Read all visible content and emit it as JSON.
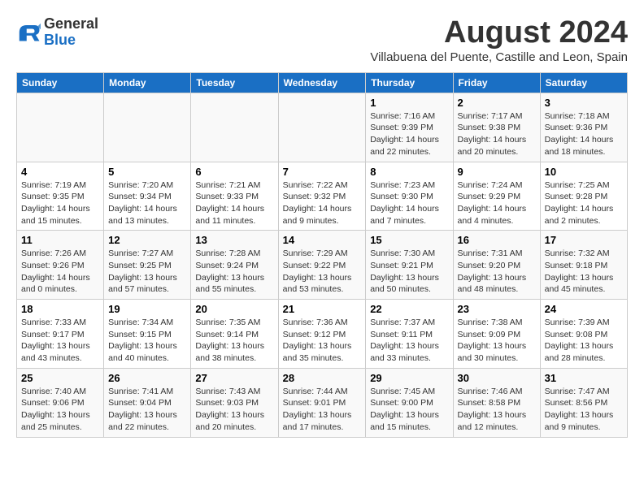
{
  "header": {
    "logo_general": "General",
    "logo_blue": "Blue",
    "month_title": "August 2024",
    "location": "Villabuena del Puente, Castille and Leon, Spain"
  },
  "weekdays": [
    "Sunday",
    "Monday",
    "Tuesday",
    "Wednesday",
    "Thursday",
    "Friday",
    "Saturday"
  ],
  "weeks": [
    [
      {
        "day": "",
        "info": ""
      },
      {
        "day": "",
        "info": ""
      },
      {
        "day": "",
        "info": ""
      },
      {
        "day": "",
        "info": ""
      },
      {
        "day": "1",
        "info": "Sunrise: 7:16 AM\nSunset: 9:39 PM\nDaylight: 14 hours\nand 22 minutes."
      },
      {
        "day": "2",
        "info": "Sunrise: 7:17 AM\nSunset: 9:38 PM\nDaylight: 14 hours\nand 20 minutes."
      },
      {
        "day": "3",
        "info": "Sunrise: 7:18 AM\nSunset: 9:36 PM\nDaylight: 14 hours\nand 18 minutes."
      }
    ],
    [
      {
        "day": "4",
        "info": "Sunrise: 7:19 AM\nSunset: 9:35 PM\nDaylight: 14 hours\nand 15 minutes."
      },
      {
        "day": "5",
        "info": "Sunrise: 7:20 AM\nSunset: 9:34 PM\nDaylight: 14 hours\nand 13 minutes."
      },
      {
        "day": "6",
        "info": "Sunrise: 7:21 AM\nSunset: 9:33 PM\nDaylight: 14 hours\nand 11 minutes."
      },
      {
        "day": "7",
        "info": "Sunrise: 7:22 AM\nSunset: 9:32 PM\nDaylight: 14 hours\nand 9 minutes."
      },
      {
        "day": "8",
        "info": "Sunrise: 7:23 AM\nSunset: 9:30 PM\nDaylight: 14 hours\nand 7 minutes."
      },
      {
        "day": "9",
        "info": "Sunrise: 7:24 AM\nSunset: 9:29 PM\nDaylight: 14 hours\nand 4 minutes."
      },
      {
        "day": "10",
        "info": "Sunrise: 7:25 AM\nSunset: 9:28 PM\nDaylight: 14 hours\nand 2 minutes."
      }
    ],
    [
      {
        "day": "11",
        "info": "Sunrise: 7:26 AM\nSunset: 9:26 PM\nDaylight: 14 hours\nand 0 minutes."
      },
      {
        "day": "12",
        "info": "Sunrise: 7:27 AM\nSunset: 9:25 PM\nDaylight: 13 hours\nand 57 minutes."
      },
      {
        "day": "13",
        "info": "Sunrise: 7:28 AM\nSunset: 9:24 PM\nDaylight: 13 hours\nand 55 minutes."
      },
      {
        "day": "14",
        "info": "Sunrise: 7:29 AM\nSunset: 9:22 PM\nDaylight: 13 hours\nand 53 minutes."
      },
      {
        "day": "15",
        "info": "Sunrise: 7:30 AM\nSunset: 9:21 PM\nDaylight: 13 hours\nand 50 minutes."
      },
      {
        "day": "16",
        "info": "Sunrise: 7:31 AM\nSunset: 9:20 PM\nDaylight: 13 hours\nand 48 minutes."
      },
      {
        "day": "17",
        "info": "Sunrise: 7:32 AM\nSunset: 9:18 PM\nDaylight: 13 hours\nand 45 minutes."
      }
    ],
    [
      {
        "day": "18",
        "info": "Sunrise: 7:33 AM\nSunset: 9:17 PM\nDaylight: 13 hours\nand 43 minutes."
      },
      {
        "day": "19",
        "info": "Sunrise: 7:34 AM\nSunset: 9:15 PM\nDaylight: 13 hours\nand 40 minutes."
      },
      {
        "day": "20",
        "info": "Sunrise: 7:35 AM\nSunset: 9:14 PM\nDaylight: 13 hours\nand 38 minutes."
      },
      {
        "day": "21",
        "info": "Sunrise: 7:36 AM\nSunset: 9:12 PM\nDaylight: 13 hours\nand 35 minutes."
      },
      {
        "day": "22",
        "info": "Sunrise: 7:37 AM\nSunset: 9:11 PM\nDaylight: 13 hours\nand 33 minutes."
      },
      {
        "day": "23",
        "info": "Sunrise: 7:38 AM\nSunset: 9:09 PM\nDaylight: 13 hours\nand 30 minutes."
      },
      {
        "day": "24",
        "info": "Sunrise: 7:39 AM\nSunset: 9:08 PM\nDaylight: 13 hours\nand 28 minutes."
      }
    ],
    [
      {
        "day": "25",
        "info": "Sunrise: 7:40 AM\nSunset: 9:06 PM\nDaylight: 13 hours\nand 25 minutes."
      },
      {
        "day": "26",
        "info": "Sunrise: 7:41 AM\nSunset: 9:04 PM\nDaylight: 13 hours\nand 22 minutes."
      },
      {
        "day": "27",
        "info": "Sunrise: 7:43 AM\nSunset: 9:03 PM\nDaylight: 13 hours\nand 20 minutes."
      },
      {
        "day": "28",
        "info": "Sunrise: 7:44 AM\nSunset: 9:01 PM\nDaylight: 13 hours\nand 17 minutes."
      },
      {
        "day": "29",
        "info": "Sunrise: 7:45 AM\nSunset: 9:00 PM\nDaylight: 13 hours\nand 15 minutes."
      },
      {
        "day": "30",
        "info": "Sunrise: 7:46 AM\nSunset: 8:58 PM\nDaylight: 13 hours\nand 12 minutes."
      },
      {
        "day": "31",
        "info": "Sunrise: 7:47 AM\nSunset: 8:56 PM\nDaylight: 13 hours\nand 9 minutes."
      }
    ]
  ]
}
